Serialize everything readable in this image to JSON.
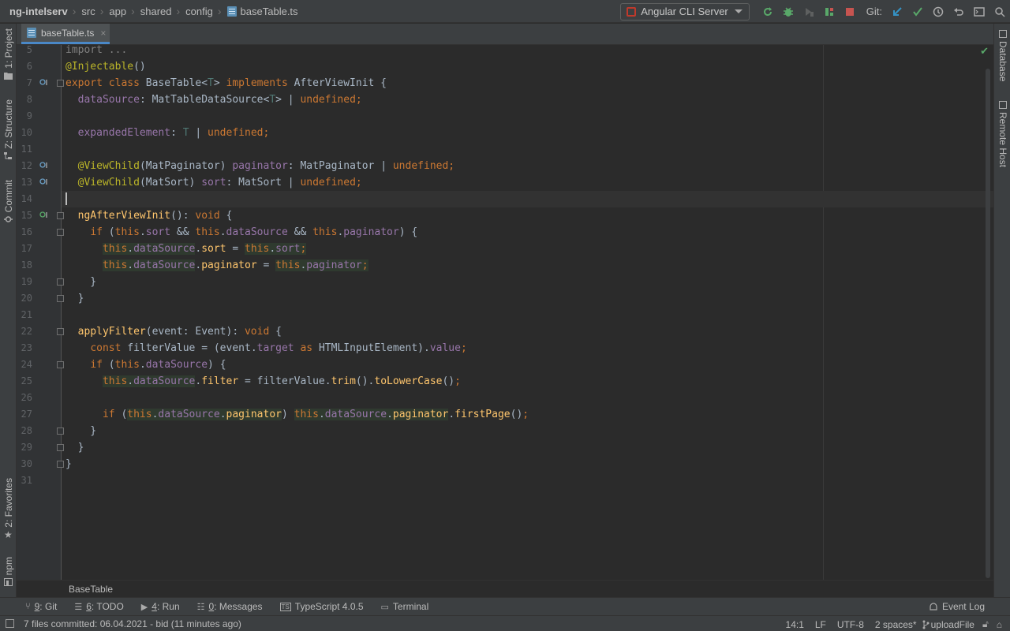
{
  "breadcrumbs": {
    "project": "ng-intelserv",
    "items": [
      "src",
      "app",
      "shared",
      "config"
    ],
    "file": "baseTable.ts"
  },
  "run_config": {
    "label": "Angular CLI Server"
  },
  "git": {
    "label": "Git:"
  },
  "left_tools": {
    "project": "1: Project",
    "structure": "Z: Structure",
    "commit": "Commit",
    "favorites": "2: Favorites",
    "npm": "npm"
  },
  "right_tools": {
    "database": "Database",
    "remote_host": "Remote Host"
  },
  "tab": {
    "label": "baseTable.ts",
    "close": "×"
  },
  "editor": {
    "caret_line": "14",
    "lines": [
      {
        "n": "5",
        "html": "<span style=\"color:#808080\">import ...</span>"
      },
      {
        "n": "6",
        "html": "<span class=\"ann\">@Injectable</span>()"
      },
      {
        "n": "7",
        "html": "<span class=\"kw\">export class </span>BaseTable&lt;<span class=\"tp\">T</span>&gt; <span class=\"kw\">implements </span>AfterViewInit {"
      },
      {
        "n": "8",
        "html": "  <span class=\"fld\">dataSource</span>: MatTableDataSource&lt;<span class=\"tp\">T</span>&gt; | <span class=\"kw\">undefined;</span>"
      },
      {
        "n": "9",
        "html": ""
      },
      {
        "n": "10",
        "html": "  <span class=\"fld\">expandedElement</span>: <span class=\"tp\">T</span> | <span class=\"kw\">undefined;</span>"
      },
      {
        "n": "11",
        "html": ""
      },
      {
        "n": "12",
        "html": "  <span class=\"ann\">@ViewChild</span>(MatPaginator) <span class=\"fld\">paginator</span>: MatPaginator | <span class=\"kw\">undefined;</span>"
      },
      {
        "n": "13",
        "html": "  <span class=\"ann\">@ViewChild</span>(MatSort) <span class=\"fld\">sort</span>: MatSort | <span class=\"kw\">undefined;</span>"
      },
      {
        "n": "14",
        "html": ""
      },
      {
        "n": "15",
        "html": "  <span class=\"fn\">ngAfterViewInit</span>(): <span class=\"kw\">void </span>{"
      },
      {
        "n": "16",
        "html": "    <span class=\"kw\">if </span>(<span class=\"ths\">this</span>.<span class=\"fld\">sort</span> &amp;&amp; <span class=\"ths\">this</span>.<span class=\"fld\">dataSource</span> &amp;&amp; <span class=\"ths\">this</span>.<span class=\"fld\">paginator</span>) {"
      },
      {
        "n": "17",
        "html": "      <span class=\"hl\"><span class=\"ths\">this</span>.<span class=\"fld\">dataSource</span></span>.<span class=\"fn\">sort</span> = <span class=\"hl\"><span class=\"ths\">this</span>.<span class=\"fld\">sort</span><span class=\"kw\">;</span></span>"
      },
      {
        "n": "18",
        "html": "      <span class=\"hl\"><span class=\"ths\">this</span>.<span class=\"fld\">dataSource</span></span>.<span class=\"fn\">paginator</span> = <span class=\"hl\"><span class=\"ths\">this</span>.<span class=\"fld\">paginator</span><span class=\"kw\">;</span></span>"
      },
      {
        "n": "19",
        "html": "    }"
      },
      {
        "n": "20",
        "html": "  }"
      },
      {
        "n": "21",
        "html": ""
      },
      {
        "n": "22",
        "html": "  <span class=\"fn\">applyFilter</span>(event: Event): <span class=\"kw\">void </span>{"
      },
      {
        "n": "23",
        "html": "    <span class=\"kw\">const </span>filterValue = (event.<span class=\"fld\">target</span> <span class=\"kw\">as </span>HTMLInputElement).<span class=\"fld\">value</span><span class=\"kw\">;</span>"
      },
      {
        "n": "24",
        "html": "    <span class=\"kw\">if </span>(<span class=\"ths\">this</span>.<span class=\"fld\">dataSource</span>) {"
      },
      {
        "n": "25",
        "html": "      <span class=\"hl\"><span class=\"ths\">this</span>.<span class=\"fld\">dataSource</span></span>.<span class=\"fn\">filter</span> = filterValue.<span class=\"fn\">trim</span>().<span class=\"fn\">toLowerCase</span>()<span class=\"kw\">;</span>"
      },
      {
        "n": "26",
        "html": ""
      },
      {
        "n": "27",
        "html": "      <span class=\"kw\">if </span>(<span class=\"hl\"><span class=\"ths\">this</span>.<span class=\"fld\">dataSource</span>.<span class=\"fn\">paginator</span></span>) <span class=\"hl\"><span class=\"ths\">this</span>.<span class=\"fld\">dataSource</span>.<span class=\"fn\">paginator</span></span>.<span class=\"fn\">firstPage</span>()<span class=\"kw\">;</span>"
      },
      {
        "n": "28",
        "html": "    }"
      },
      {
        "n": "29",
        "html": "  }"
      },
      {
        "n": "30",
        "html": "}"
      },
      {
        "n": "31",
        "html": ""
      }
    ]
  },
  "editor_breadcrumb": "BaseTable",
  "tool_windows": [
    {
      "key": "9",
      "label": ": Git",
      "icon": "git-branch-icon"
    },
    {
      "key": "6",
      "label": ": TODO",
      "icon": "list-icon"
    },
    {
      "key": "4",
      "label": ": Run",
      "icon": "play-icon"
    },
    {
      "key": "0",
      "label": ": Messages",
      "icon": "messages-icon"
    },
    {
      "key": "",
      "label": "TypeScript 4.0.5",
      "icon": "typescript-icon"
    },
    {
      "key": "",
      "label": "Terminal",
      "icon": "terminal-icon"
    }
  ],
  "event_log": "Event Log",
  "status": {
    "message": "7 files committed: 06.04.2021 - bid (11 minutes ago)",
    "position": "14:1",
    "line_sep": "LF",
    "encoding": "UTF-8",
    "indent": "2 spaces*",
    "branch": "uploadFile"
  },
  "colors": {
    "keyword": "#cc7832",
    "annotation": "#bbb529",
    "field": "#9876aa",
    "function": "#ffc66d",
    "accent": "#4a88c7"
  }
}
